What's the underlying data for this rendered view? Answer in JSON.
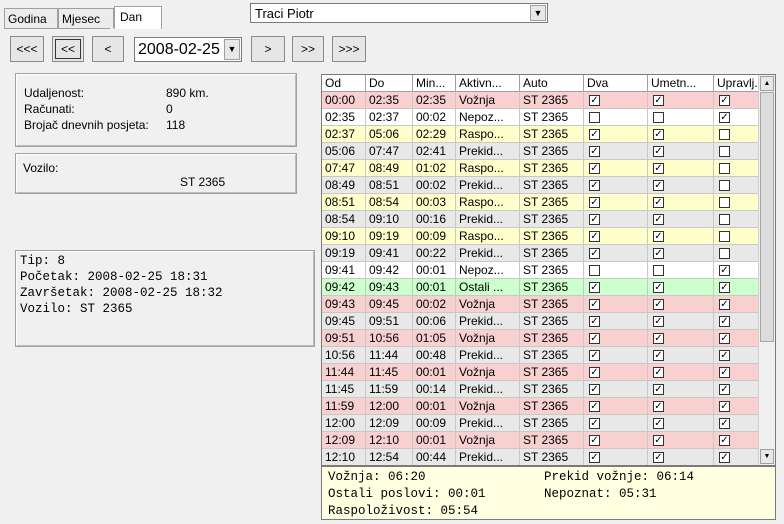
{
  "tabs": [
    {
      "label": "Godina",
      "active": false
    },
    {
      "label": "Mjesec",
      "active": false
    },
    {
      "label": "Dan",
      "active": true
    }
  ],
  "driver_select": {
    "value": "Traci Piotr"
  },
  "nav": {
    "first": "<<<",
    "prev_week": "<<",
    "prev_day": "<",
    "date": "2008-02-25",
    "next_day": ">",
    "next_week": ">>",
    "last": ">>>"
  },
  "stats": {
    "distance_label": "Udaljenost:",
    "distance_value": "890 km.",
    "computed_label": "Računati:",
    "computed_value": "0",
    "visits_label": "Brojač dnevnih posjeta:",
    "visits_value": "118"
  },
  "vehicle_box": {
    "label": "Vozilo:",
    "value": "ST 2365"
  },
  "detail_box": {
    "line1": "Tip: 8",
    "line2": "Početak: 2008-02-25 18:31",
    "line3": "Završetak: 2008-02-25 18:32",
    "line4": "Vozilo: ST 2365"
  },
  "colors": {
    "red": "#f8d0d0",
    "yellow": "#ffffcc",
    "grey": "#e8e8e8",
    "green": "#ccffcc",
    "white": "#ffffff"
  },
  "table": {
    "columns": [
      "Od",
      "Do",
      "Min...",
      "Aktivn...",
      "Auto",
      "Dva",
      "Umetn...",
      "Upravlj..."
    ],
    "rows": [
      {
        "od": "00:00",
        "do": "02:35",
        "min": "02:35",
        "akt": "Vožnja",
        "auto": "ST 2365",
        "dva": true,
        "umet": true,
        "upr": true,
        "color": "red"
      },
      {
        "od": "02:35",
        "do": "02:37",
        "min": "00:02",
        "akt": "Nepoz...",
        "auto": "ST 2365",
        "dva": false,
        "umet": false,
        "upr": true,
        "color": "white"
      },
      {
        "od": "02:37",
        "do": "05:06",
        "min": "02:29",
        "akt": "Raspo...",
        "auto": "ST 2365",
        "dva": true,
        "umet": true,
        "upr": false,
        "color": "yellow"
      },
      {
        "od": "05:06",
        "do": "07:47",
        "min": "02:41",
        "akt": "Prekid...",
        "auto": "ST 2365",
        "dva": true,
        "umet": true,
        "upr": false,
        "color": "grey"
      },
      {
        "od": "07:47",
        "do": "08:49",
        "min": "01:02",
        "akt": "Raspo...",
        "auto": "ST 2365",
        "dva": true,
        "umet": true,
        "upr": false,
        "color": "yellow"
      },
      {
        "od": "08:49",
        "do": "08:51",
        "min": "00:02",
        "akt": "Prekid...",
        "auto": "ST 2365",
        "dva": true,
        "umet": true,
        "upr": false,
        "color": "grey"
      },
      {
        "od": "08:51",
        "do": "08:54",
        "min": "00:03",
        "akt": "Raspo...",
        "auto": "ST 2365",
        "dva": true,
        "umet": true,
        "upr": false,
        "color": "yellow"
      },
      {
        "od": "08:54",
        "do": "09:10",
        "min": "00:16",
        "akt": "Prekid...",
        "auto": "ST 2365",
        "dva": true,
        "umet": true,
        "upr": false,
        "color": "grey"
      },
      {
        "od": "09:10",
        "do": "09:19",
        "min": "00:09",
        "akt": "Raspo...",
        "auto": "ST 2365",
        "dva": true,
        "umet": true,
        "upr": false,
        "color": "yellow"
      },
      {
        "od": "09:19",
        "do": "09:41",
        "min": "00:22",
        "akt": "Prekid...",
        "auto": "ST 2365",
        "dva": true,
        "umet": true,
        "upr": false,
        "color": "grey"
      },
      {
        "od": "09:41",
        "do": "09:42",
        "min": "00:01",
        "akt": "Nepoz...",
        "auto": "ST 2365",
        "dva": false,
        "umet": false,
        "upr": true,
        "color": "white"
      },
      {
        "od": "09:42",
        "do": "09:43",
        "min": "00:01",
        "akt": "Ostali ...",
        "auto": "ST 2365",
        "dva": true,
        "umet": true,
        "upr": true,
        "color": "green"
      },
      {
        "od": "09:43",
        "do": "09:45",
        "min": "00:02",
        "akt": "Vožnja",
        "auto": "ST 2365",
        "dva": true,
        "umet": true,
        "upr": true,
        "color": "red"
      },
      {
        "od": "09:45",
        "do": "09:51",
        "min": "00:06",
        "akt": "Prekid...",
        "auto": "ST 2365",
        "dva": true,
        "umet": true,
        "upr": true,
        "color": "grey"
      },
      {
        "od": "09:51",
        "do": "10:56",
        "min": "01:05",
        "akt": "Vožnja",
        "auto": "ST 2365",
        "dva": true,
        "umet": true,
        "upr": true,
        "color": "red"
      },
      {
        "od": "10:56",
        "do": "11:44",
        "min": "00:48",
        "akt": "Prekid...",
        "auto": "ST 2365",
        "dva": true,
        "umet": true,
        "upr": true,
        "color": "grey"
      },
      {
        "od": "11:44",
        "do": "11:45",
        "min": "00:01",
        "akt": "Vožnja",
        "auto": "ST 2365",
        "dva": true,
        "umet": true,
        "upr": true,
        "color": "red"
      },
      {
        "od": "11:45",
        "do": "11:59",
        "min": "00:14",
        "akt": "Prekid...",
        "auto": "ST 2365",
        "dva": true,
        "umet": true,
        "upr": true,
        "color": "grey"
      },
      {
        "od": "11:59",
        "do": "12:00",
        "min": "00:01",
        "akt": "Vožnja",
        "auto": "ST 2365",
        "dva": true,
        "umet": true,
        "upr": true,
        "color": "red"
      },
      {
        "od": "12:00",
        "do": "12:09",
        "min": "00:09",
        "akt": "Prekid...",
        "auto": "ST 2365",
        "dva": true,
        "umet": true,
        "upr": true,
        "color": "grey"
      },
      {
        "od": "12:09",
        "do": "12:10",
        "min": "00:01",
        "akt": "Vožnja",
        "auto": "ST 2365",
        "dva": true,
        "umet": true,
        "upr": true,
        "color": "red"
      },
      {
        "od": "12:10",
        "do": "12:54",
        "min": "00:44",
        "akt": "Prekid...",
        "auto": "ST 2365",
        "dva": true,
        "umet": true,
        "upr": true,
        "color": "grey"
      }
    ]
  },
  "summary": {
    "driving": "Vožnja: 06:20",
    "break": "Prekid vožnje: 06:14",
    "other": "Ostali poslovi: 00:01",
    "unknown": "Nepoznat: 05:31",
    "availability": "Raspoloživost: 05:54"
  }
}
